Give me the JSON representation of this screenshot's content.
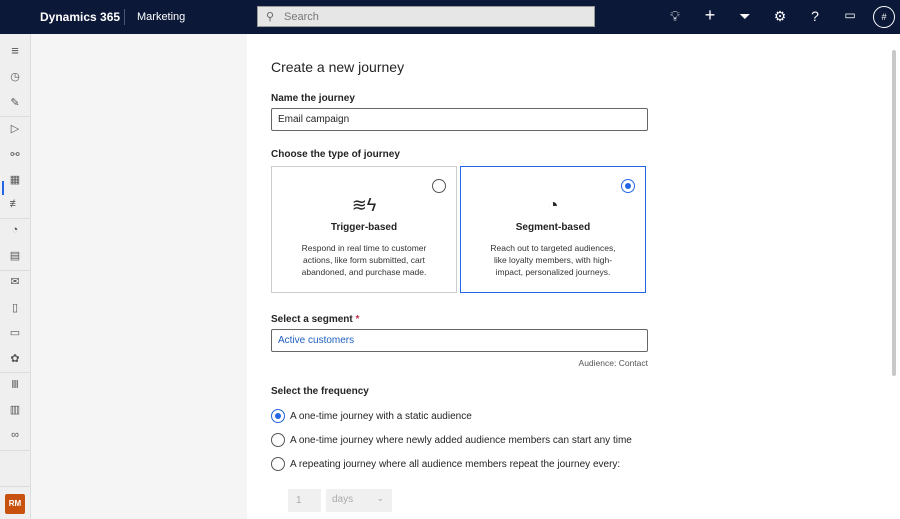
{
  "topbar": {
    "brand": "Dynamics 365",
    "app": "Marketing",
    "search_placeholder": "Search",
    "avatar": "#"
  },
  "sidebar": {
    "user_initials": "RM"
  },
  "form": {
    "title": "Create a new journey",
    "name_label": "Name the journey",
    "name_value": "Email campaign",
    "type_label": "Choose the type of journey",
    "types": [
      {
        "title": "Trigger-based",
        "desc": "Respond in real time to customer actions, like form submitted, cart abandoned, and purchase made.",
        "selected": false
      },
      {
        "title": "Segment-based",
        "desc": "Reach out to targeted audiences, like loyalty members, with high-impact, personalized journeys.",
        "selected": true
      }
    ],
    "segment_label": "Select a segment",
    "required_mark": "*",
    "segment_value": "Active customers",
    "audience_note": "Audience: Contact",
    "frequency_label": "Select the frequency",
    "frequency_options": [
      "A one-time journey with a static audience",
      "A one-time journey where newly added audience members can start any time",
      "A repeating journey where all audience members repeat the journey every:"
    ],
    "repeat_count": "1",
    "repeat_unit": "days"
  },
  "colors": {
    "accent": "#2266e3",
    "topbar": "#0b1838",
    "link": "#1f5fbf"
  }
}
